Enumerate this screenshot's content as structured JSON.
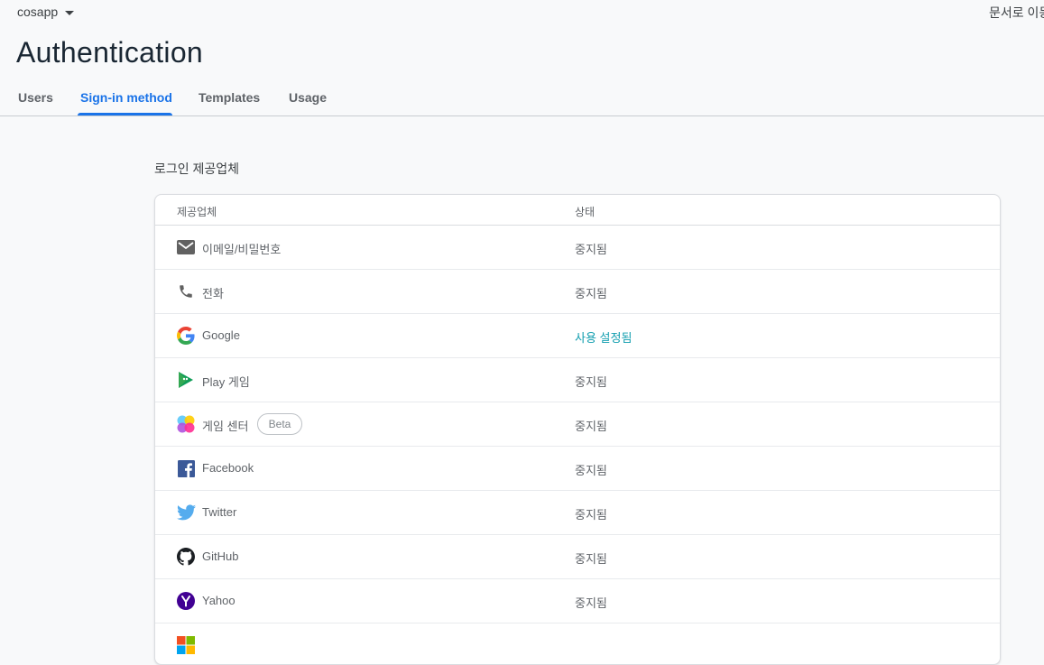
{
  "project": {
    "name": "cosapp"
  },
  "header": {
    "docs_link": "문서로 이동",
    "title": "Authentication"
  },
  "tabs": [
    {
      "label": "Users"
    },
    {
      "label": "Sign-in method"
    },
    {
      "label": "Templates"
    },
    {
      "label": "Usage"
    }
  ],
  "section": {
    "title": "로그인 제공업체"
  },
  "table": {
    "headers": {
      "provider": "제공업체",
      "status": "상태"
    },
    "rows": [
      {
        "name": "이메일/비밀번호",
        "status": "중지됨",
        "icon": "email-icon"
      },
      {
        "name": "전화",
        "status": "중지됨",
        "icon": "phone-icon"
      },
      {
        "name": "Google",
        "status": "사용 설정됨",
        "icon": "google-icon"
      },
      {
        "name": "Play 게임",
        "status": "중지됨",
        "icon": "play-games-icon"
      },
      {
        "name": "게임 센터",
        "badge": "Beta",
        "status": "중지됨",
        "icon": "game-center-icon"
      },
      {
        "name": "Facebook",
        "status": "중지됨",
        "icon": "facebook-icon"
      },
      {
        "name": "Twitter",
        "status": "중지됨",
        "icon": "twitter-icon"
      },
      {
        "name": "GitHub",
        "status": "중지됨",
        "icon": "github-icon"
      },
      {
        "name": "Yahoo",
        "status": "중지됨",
        "icon": "yahoo-icon"
      },
      {
        "name": "",
        "status": "",
        "icon": "microsoft-icon"
      }
    ]
  },
  "colors": {
    "accent": "#1a73e8",
    "enabled": "#129eaf",
    "muted": "#5f6368"
  }
}
